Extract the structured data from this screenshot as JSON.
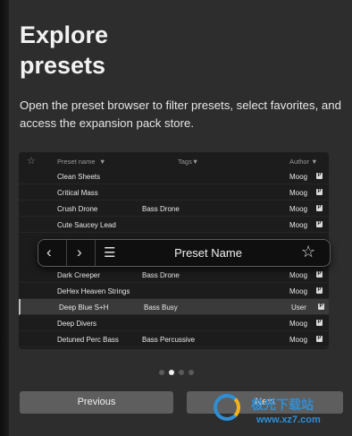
{
  "dialog": {
    "title_line1": "Explore",
    "title_line2": "presets",
    "description": "Open the preset browser to filter presets, select favorites, and access the expansion pack store."
  },
  "browser": {
    "columns": {
      "favorite_icon": "star-outline-icon",
      "name": "Preset name",
      "name_sort": "▼",
      "tags": "Tags▼",
      "author": "Author ▼"
    },
    "rows": [
      {
        "name": "Clean Sheets",
        "tag": "",
        "author": "Moog",
        "selected": false
      },
      {
        "name": "Critical Mass",
        "tag": "",
        "author": "Moog",
        "selected": false
      },
      {
        "name": "Crush Drone",
        "tag": "Bass Drone",
        "author": "Moog",
        "selected": false
      },
      {
        "name": "Cute Saucey Lead",
        "tag": "",
        "author": "Moog",
        "selected": false
      },
      {
        "name": "Dark Creeper",
        "tag": "Bass Drone",
        "author": "Moog",
        "selected": false
      },
      {
        "name": "DeHex Heaven Strings",
        "tag": "",
        "author": "Moog",
        "selected": false
      },
      {
        "name": "Deep Blue S+H",
        "tag": "Bass Busy",
        "author": "User",
        "selected": true
      },
      {
        "name": "Deep Divers",
        "tag": "",
        "author": "Moog",
        "selected": false
      },
      {
        "name": "Detuned Perc Bass",
        "tag": "Bass Percussive",
        "author": "Moog",
        "selected": false
      }
    ],
    "row_badge": "P"
  },
  "preset_bar": {
    "prev_icon": "chevron-left-icon",
    "next_icon": "chevron-right-icon",
    "menu_icon": "hamburger-menu-icon",
    "preset_name": "Preset Name",
    "favorite_icon": "star-outline-icon"
  },
  "pager": {
    "total": 4,
    "current": 2
  },
  "buttons": {
    "previous": "Previous",
    "next": "Next"
  },
  "watermark": {
    "line1": "极光下载站",
    "line2": "www.xz7.com"
  }
}
